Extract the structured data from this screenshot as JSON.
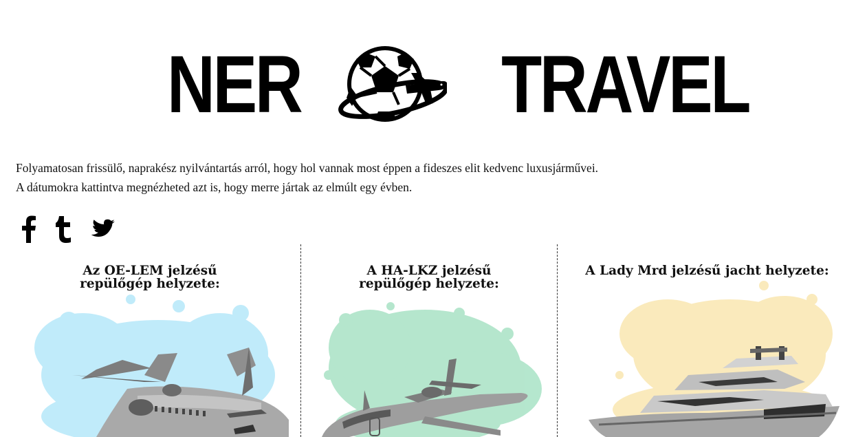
{
  "logo": {
    "left_word": "NER",
    "right_word": "TRAVEL",
    "emblem_icon": "soccer-ball-with-airplane"
  },
  "intro": {
    "line1": "Folyamatosan frissülő, naprakész nyilvántartás arról, hogy hol vannak most éppen a fideszes elit kedvenc luxusjárművei.",
    "line2": "A dátumokra kattintva megnézheted azt is, hogy merre jártak az elmúlt egy évben."
  },
  "social": [
    {
      "icon": "facebook-icon"
    },
    {
      "icon": "tumblr-icon"
    },
    {
      "icon": "twitter-icon"
    }
  ],
  "cards": [
    {
      "title": "Az OE-LEM jelzésű repülőgép helyzete:",
      "vehicle": "airplane",
      "accent": "#7ad3f5"
    },
    {
      "title": "A HA-LKZ jelzésű repülőgép helyzete:",
      "vehicle": "airplane",
      "accent": "#6fcf9e"
    },
    {
      "title": "A Lady Mrd jelzésű jacht helyzete:",
      "vehicle": "yacht",
      "accent": "#f7d98a"
    }
  ]
}
